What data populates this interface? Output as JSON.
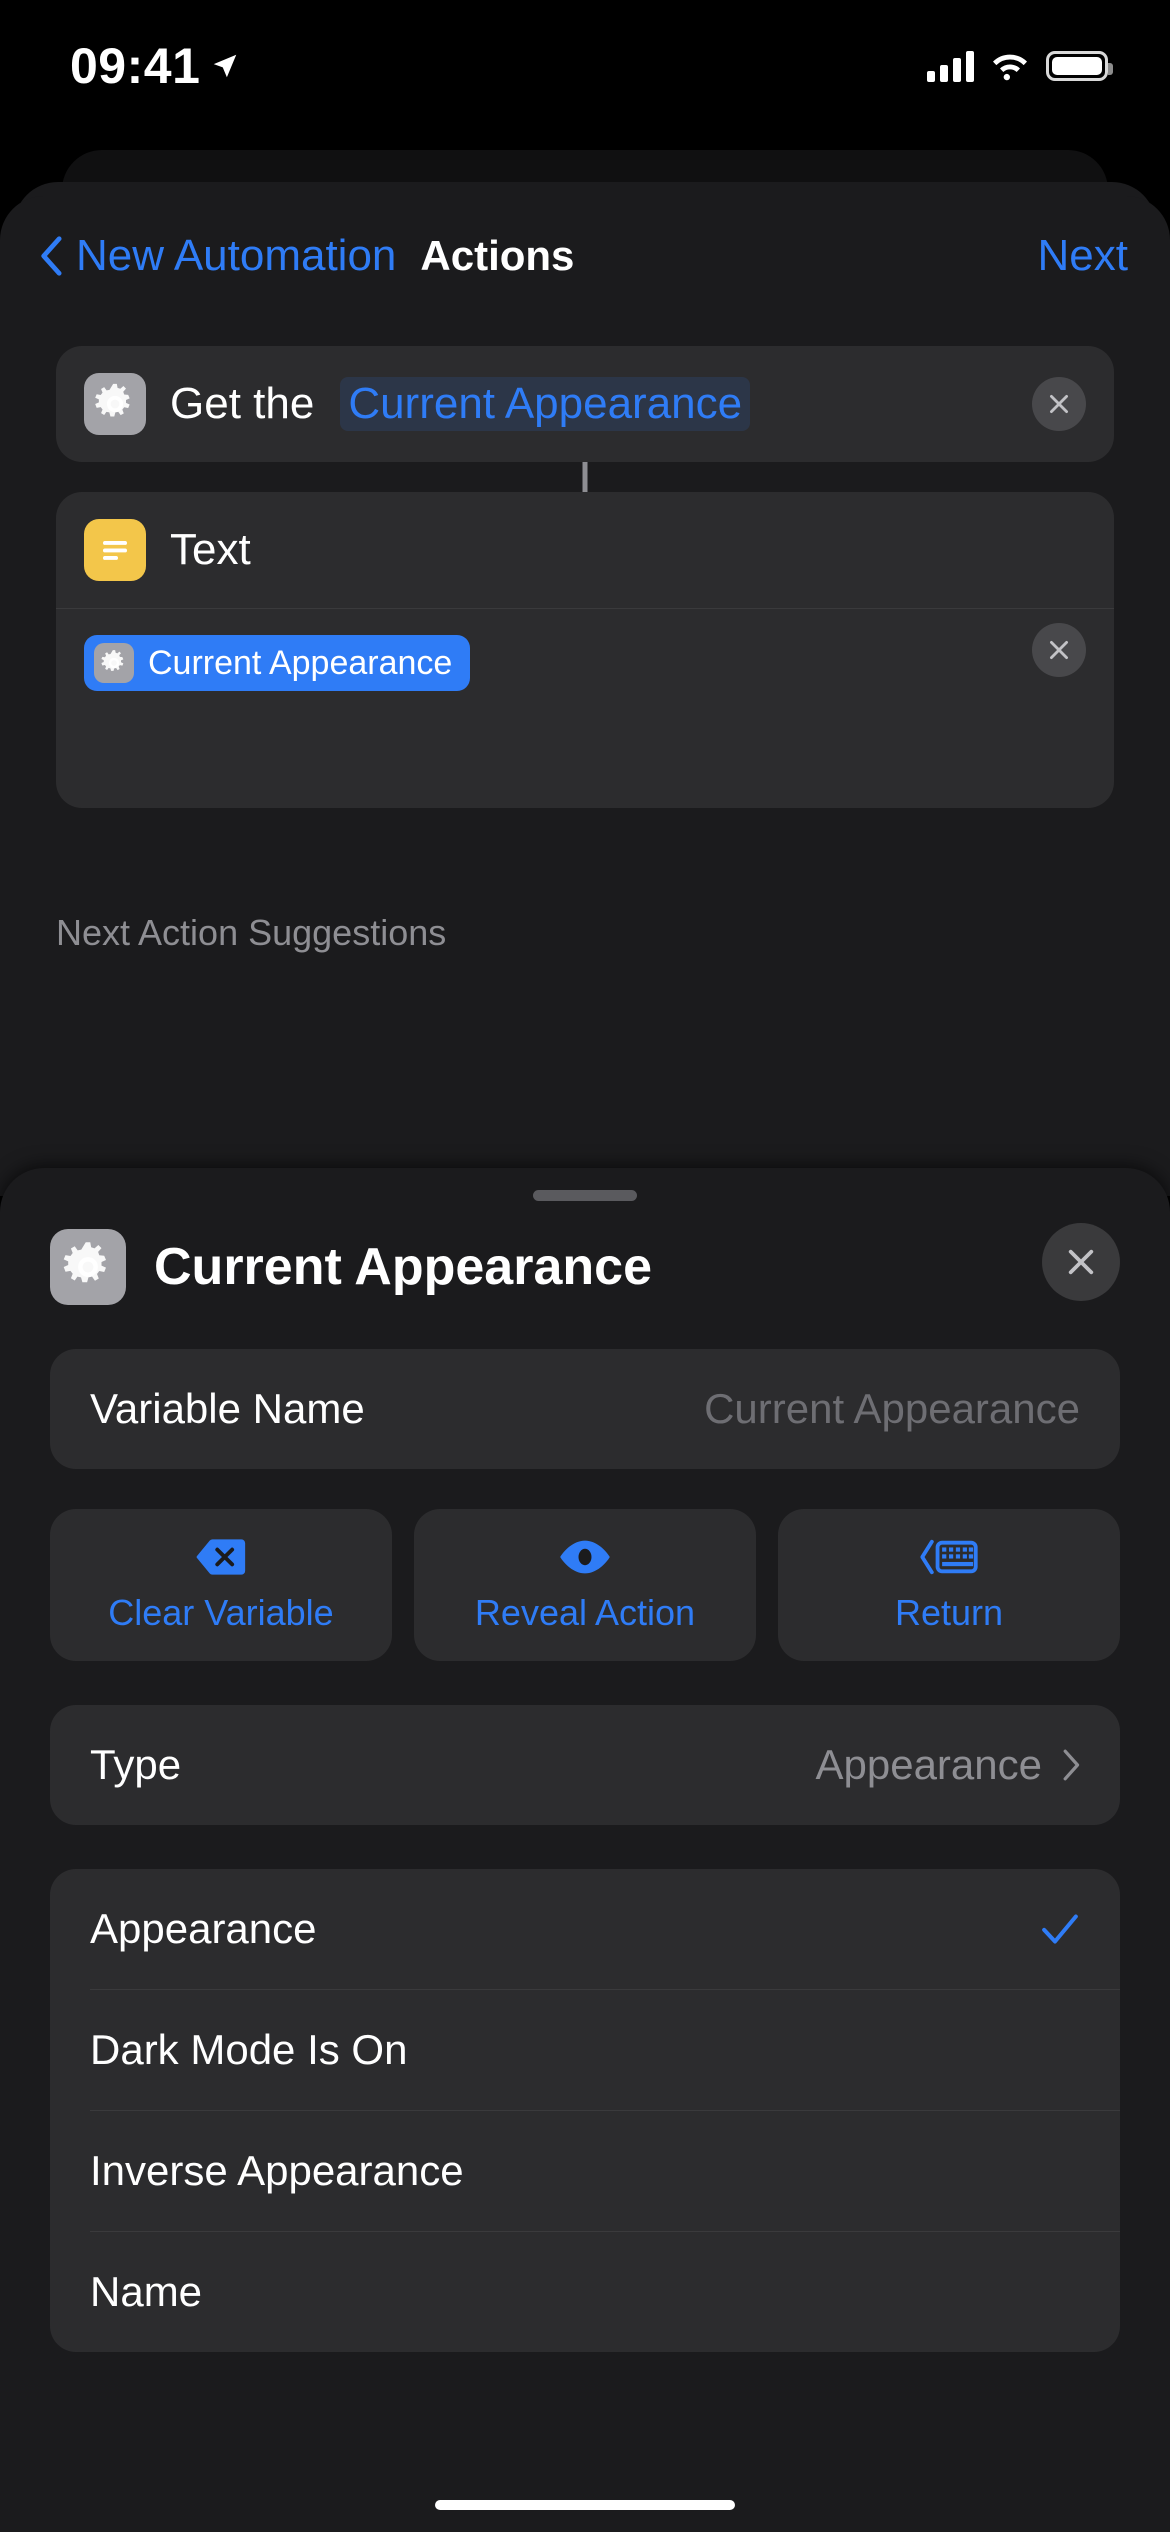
{
  "status_bar": {
    "time": "09:41",
    "location_icon": "location-arrow-icon",
    "cellular_icon": "cellular-bars-icon",
    "wifi_icon": "wifi-icon",
    "battery_icon": "battery-icon"
  },
  "nav": {
    "back_icon": "chevron-left-icon",
    "back_label": "New Automation",
    "title": "Actions",
    "next_label": "Next"
  },
  "actions": [
    {
      "icon": "gear-icon",
      "title": "Get the",
      "param": "Current Appearance",
      "remove_icon": "close-icon"
    },
    {
      "icon": "text-lines-icon",
      "title": "Text",
      "remove_icon": "close-icon",
      "variable_pill": {
        "icon": "gear-icon",
        "label": "Current Appearance"
      }
    }
  ],
  "suggestions_heading": "Next Action Suggestions",
  "sheet": {
    "icon": "gear-icon",
    "title": "Current Appearance",
    "close_icon": "close-icon",
    "grabber": "sheet-grabber",
    "variable_name": {
      "label": "Variable Name",
      "placeholder": "Current Appearance",
      "value": ""
    },
    "buttons": [
      {
        "icon": "delete-left-icon",
        "label": "Clear Variable"
      },
      {
        "icon": "eye-icon",
        "label": "Reveal Action"
      },
      {
        "icon": "keyboard-return-icon",
        "label": "Return"
      }
    ],
    "type_row": {
      "label": "Type",
      "value": "Appearance",
      "chevron_icon": "chevron-right-icon"
    },
    "options": [
      {
        "label": "Appearance",
        "selected": true,
        "check_icon": "checkmark-icon"
      },
      {
        "label": "Dark Mode Is On",
        "selected": false
      },
      {
        "label": "Inverse Appearance",
        "selected": false
      },
      {
        "label": "Name",
        "selected": false
      }
    ]
  },
  "colors": {
    "accent": "#2f7cf6",
    "card": "#2c2c2e",
    "background": "#1b1b1d",
    "text_icon_yellow": "#f3c64a",
    "gear_gray": "#a3a3a8",
    "secondary_text": "#8e8e93"
  },
  "home_indicator": "home-indicator"
}
